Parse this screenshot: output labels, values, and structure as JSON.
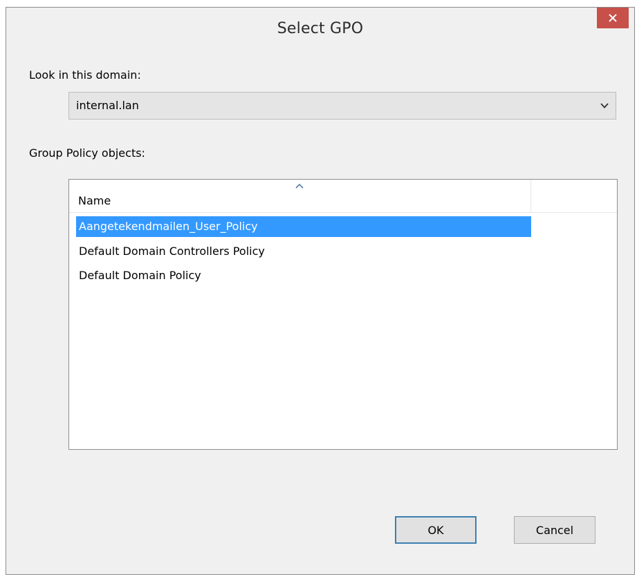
{
  "dialog": {
    "title": "Select GPO",
    "close_icon": "close-icon"
  },
  "domain": {
    "label": "Look in this domain:",
    "selected": "internal.lan",
    "dropdown_icon": "chevron-down-icon"
  },
  "gpo_list": {
    "label": "Group Policy objects:",
    "columns": [
      {
        "label": "Name",
        "sort": "ascending"
      }
    ],
    "rows": [
      {
        "name": "Aangetekendmailen_User_Policy",
        "selected": true
      },
      {
        "name": "Default Domain Controllers Policy",
        "selected": false
      },
      {
        "name": "Default Domain Policy",
        "selected": false
      }
    ]
  },
  "buttons": {
    "ok": "OK",
    "cancel": "Cancel"
  },
  "colors": {
    "selection": "#3399ff",
    "close_button": "#c7504a",
    "default_button_border": "#3c7fb1"
  }
}
